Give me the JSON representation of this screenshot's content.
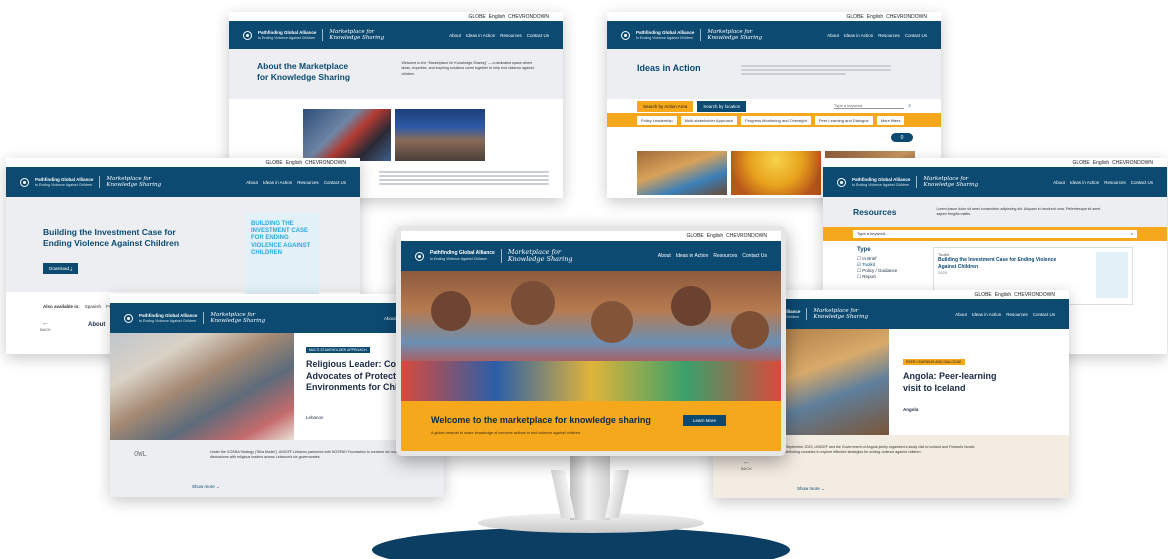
{
  "utility": {
    "globe_label": "GLOBE",
    "lang": "English",
    "chevron": "CHEVRONDOWN"
  },
  "brand": {
    "org": "Pathfinding Global Alliance",
    "tagline": "to Ending Violence Against Children",
    "product_l1": "Marketplace for",
    "product_l2": "Knowledge Sharing"
  },
  "nav": {
    "about": "About",
    "ideas": "Ideas in Action",
    "resources": "Resources",
    "contact": "Contact Us"
  },
  "about_page": {
    "title_l1": "About the Marketplace",
    "title_l2": "for Knowledge Sharing",
    "intro": "Welcome to the \"Marketplace for Knowledge Sharing\" — a dedicated space where ideas, expertise, and inspiring solutions come together to help end violence against children."
  },
  "ideas_page": {
    "title": "Ideas in Action",
    "tab_area": "Search by Action Area",
    "tab_location": "Search by location",
    "search_placeholder": "Type a keyword",
    "chips": [
      "Policy Leadership",
      "Multi-stakeholder Approach",
      "Progress Monitoring and Oversight",
      "Peer Learning and Dialogue"
    ],
    "more": "More filters",
    "count": "0"
  },
  "investment_page": {
    "title_l1": "Building the Investment Case for",
    "title_l2": "Ending Violence Against Children",
    "download": "Download",
    "also": "Also available in:",
    "langs": [
      "Spanish",
      "French",
      "Arabic"
    ],
    "cover_text": "BUILDING THE INVESTMENT CASE FOR ENDING VIOLENCE AGAINST CHILDREN",
    "about": "About",
    "back": "BACK"
  },
  "resources_page": {
    "title": "Resources",
    "desc": "Lorem ipsum dolor sit amet consectetur adipiscing elit. Aliquam in hendrerit urna. Pellentesque sit amet sapien fringilla mattis.",
    "search_placeholder": "Type a keyword...",
    "filter": "Type",
    "options": [
      "In Brief",
      "Toolkit",
      "Policy / Guidance",
      "Report"
    ],
    "result_tag": "Toolkit",
    "result_title": "Building the Investment Case for Ending Violence Against Children",
    "result_meta": "2024"
  },
  "religious_page": {
    "tag": "MULTI-STAKEHOLDER APPROACH",
    "title_l1": "Religious Leader: Com",
    "title_l2": "Advocates of Protective",
    "title_l3": "Environments for Child",
    "location": "Lebanon",
    "body": "Under the GOSNA Strategy ('Shia Model'), UNICEF Lebanon partnered with NOSPAH Foundation to convene six roundtable discussions with religious leaders across Lebanon's six governorates.",
    "show_more": "Show more",
    "partner": "OWL"
  },
  "angola_page": {
    "tag": "PEER LEARNING AND DIALOGUE",
    "title_l1": "Angola: Peer-learning",
    "title_l2": "visit to Iceland",
    "location": "Angola",
    "body": "In September 2023, UNICEF and the Government of Angola jointly organised a study visit to Iceland and Finland's Nordic Pathfinding countries to explore effective strategies for ending violence against children.",
    "show_more": "Show more",
    "back": "BACK"
  },
  "home": {
    "hero_title": "Welcome to the marketplace for knowledge sharing",
    "hero_sub": "A global network to share knowledge of concrete actions to end violence against children.",
    "learn_more": "Learn More"
  },
  "colors": {
    "navy": "#0c4a72",
    "orange": "#f5a81c",
    "light_blue": "#29a9e0"
  }
}
